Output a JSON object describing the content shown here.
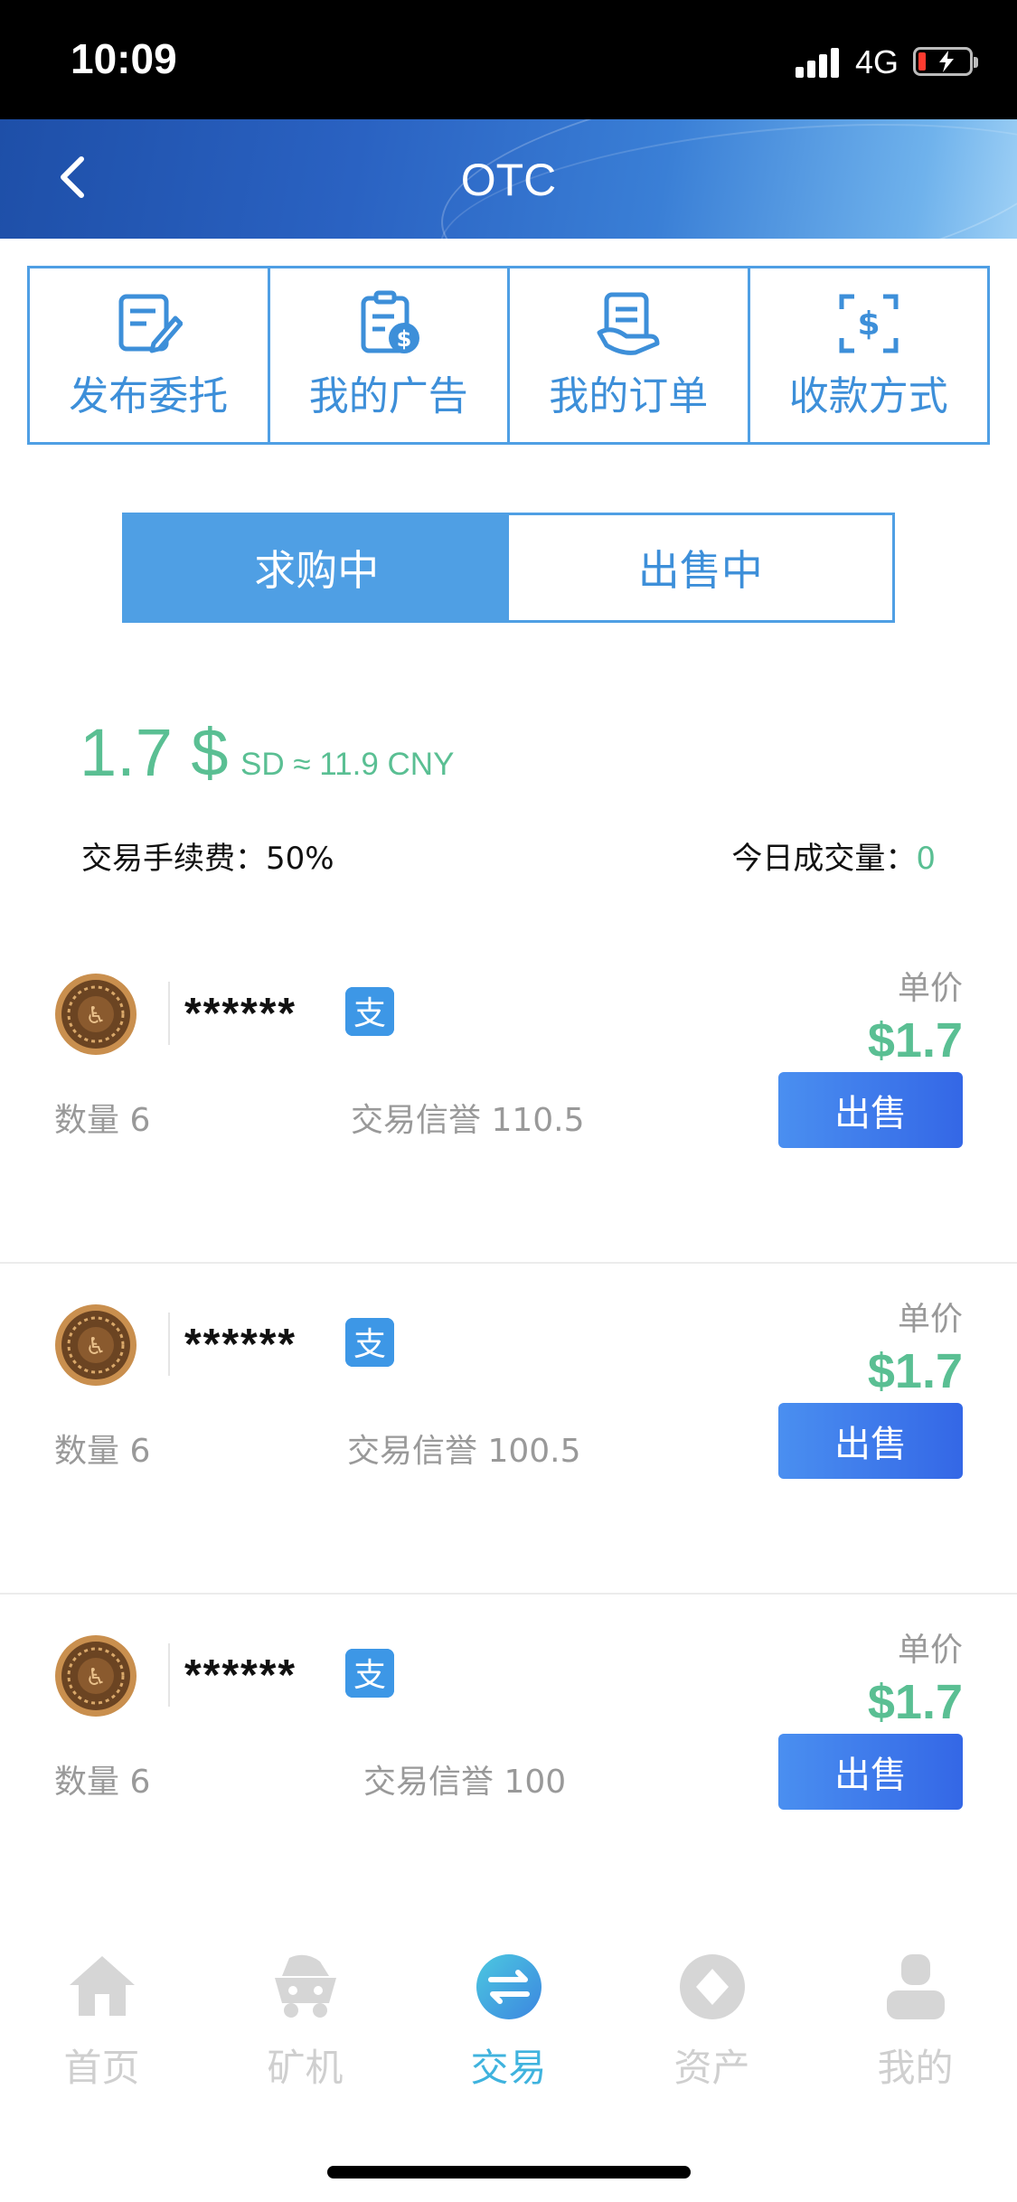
{
  "status_bar": {
    "time": "10:09",
    "network": "4G"
  },
  "header": {
    "title": "OTC"
  },
  "quick_menu": [
    {
      "label": "发布委托",
      "icon": "publish-icon"
    },
    {
      "label": "我的广告",
      "icon": "ad-icon"
    },
    {
      "label": "我的订单",
      "icon": "order-icon"
    },
    {
      "label": "收款方式",
      "icon": "payment-method-icon"
    }
  ],
  "tabs": [
    {
      "label": "求购中",
      "active": true
    },
    {
      "label": "出售中",
      "active": false
    }
  ],
  "summary": {
    "price": "1.7 $",
    "price_sub": "SD ≈ 11.9 CNY",
    "fee": "交易手续费：50%",
    "volume_label": "今日成交量：",
    "volume_value": "0"
  },
  "listings": [
    {
      "name": "******",
      "unit_label": "单价",
      "unit_price": "$1.7",
      "quantity": "数量  6",
      "credit": "交易信誉  110.5",
      "action": "出售"
    },
    {
      "name": "******",
      "unit_label": "单价",
      "unit_price": "$1.7",
      "quantity": "数量  6",
      "credit": "交易信誉  100.5",
      "action": "出售"
    },
    {
      "name": "******",
      "unit_label": "单价",
      "unit_price": "$1.7",
      "quantity": "数量  6",
      "credit": "交易信誉  100",
      "action": "出售"
    }
  ],
  "bottom_nav": [
    {
      "label": "首页",
      "icon": "home-icon",
      "active": false
    },
    {
      "label": "矿机",
      "icon": "mining-cart-icon",
      "active": false
    },
    {
      "label": "交易",
      "icon": "exchange-icon",
      "active": true
    },
    {
      "label": "资产",
      "icon": "asset-icon",
      "active": false
    },
    {
      "label": "我的",
      "icon": "profile-icon",
      "active": false
    }
  ],
  "colors": {
    "accent": "#4f9fe4",
    "price_green": "#5abf93",
    "button_blue": "#3467e6",
    "nav_active": "#3fb3de",
    "nav_inactive": "#cfcfcf"
  }
}
